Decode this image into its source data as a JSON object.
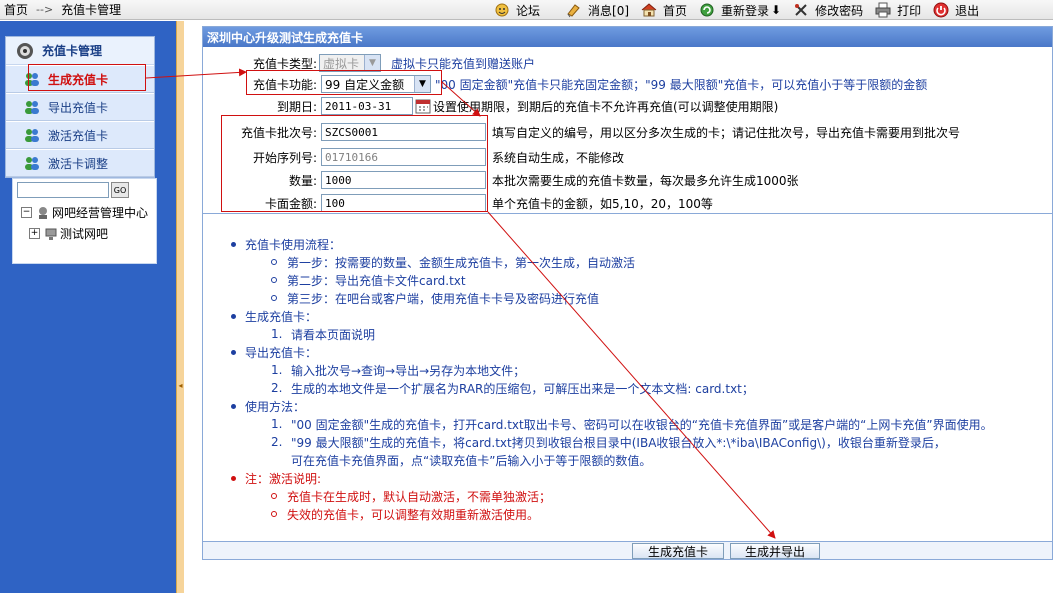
{
  "breadcrumb": {
    "home": "首页",
    "separator": "-->",
    "current": "充值卡管理"
  },
  "top_menu": [
    {
      "label": "论坛",
      "icon": "forum-icon"
    },
    {
      "label": "消息[0]",
      "icon": "message-icon"
    },
    {
      "label": "首页",
      "icon": "home-icon"
    },
    {
      "label": "重新登录",
      "icon": "relogin-icon"
    },
    {
      "label": "修改密码",
      "icon": "password-icon"
    },
    {
      "label": "打印",
      "icon": "print-icon"
    },
    {
      "label": "退出",
      "icon": "exit-icon"
    }
  ],
  "sidebar": {
    "title": "充值卡管理",
    "items": [
      {
        "label": "生成充值卡",
        "active": true
      },
      {
        "label": "导出充值卡",
        "active": false
      },
      {
        "label": "激活充值卡",
        "active": false
      },
      {
        "label": "激活卡调整",
        "active": false
      }
    ],
    "tree": {
      "search_value": "",
      "go_label": "GO",
      "nodes": [
        {
          "toggle": "−",
          "label": "网吧经营管理中心"
        },
        {
          "toggle": "+",
          "label": "测试网吧"
        }
      ]
    }
  },
  "panel": {
    "title": "深圳中心升级测试生成充值卡",
    "fields": {
      "card_type": {
        "label": "充值卡类型:",
        "value": "虚拟卡",
        "hint": "虚拟卡只能充值到赠送账户"
      },
      "card_func": {
        "label": "充值卡功能:",
        "value": "99 自定义金额",
        "hint_part1": "\"00 固定金额\"充值卡只能充固定金额；\"99 最大限额\"充值卡，可以充值小于等于限额的金额"
      },
      "expire": {
        "label": "到期日:",
        "value": "2011-03-31",
        "hint": "设置使用期限，到期后的充值卡不允许再充值(可以调整使用期限)"
      },
      "batch": {
        "label": "充值卡批次号:",
        "value": "SZCS0001",
        "hint": "填写自定义的编号，用以区分多次生成的卡；请记住批次号，导出充值卡需要用到批次号"
      },
      "start_serial": {
        "label": "开始序列号:",
        "value": "01710166",
        "hint": "系统自动生成，不能修改"
      },
      "quantity": {
        "label": "数量:",
        "value": "1000",
        "hint": "本批次需要生成的充值卡数量，每次最多允许生成1000张"
      },
      "face_value": {
        "label": "卡面金额:",
        "value": "100",
        "hint": "单个充值卡的金额，如5,10，20，100等"
      }
    },
    "instructions": {
      "s1": "充值卡使用流程：",
      "s1_1": "第一步：按需要的数量、金额生成充值卡，第一次生成，自动激活",
      "s1_2": "第二步：导出充值卡文件card.txt",
      "s1_3": "第三步：在吧台或客户端，使用充值卡卡号及密码进行充值",
      "s2": "生成充值卡：",
      "s2_1": "请看本页面说明",
      "s3": "导出充值卡：",
      "s3_1": "输入批次号→查询→导出→另存为本地文件；",
      "s3_2": "生成的本地文件是一个扩展名为RAR的压缩包，可解压出来是一个文本文档: card.txt；",
      "s4": "使用方法：",
      "s4_1": "\"00 固定金额\"生成的充值卡，打开card.txt取出卡号、密码可以在收银台的“充值卡充值界面”或是客户端的“上网卡充值”界面使用。",
      "s4_2": "\"99 最大限额\"生成的充值卡，将card.txt拷贝到收银台根目录中(IBA收银台放入*:\\*iba\\IBAConfig\\)，收银台重新登录后，",
      "s4_2b": "可在充值卡充值界面，点“读取充值卡”后输入小于等于限额的数值。",
      "s5": "注：激活说明:",
      "s5_1": "充值卡在生成时，默认自动激活，不需单独激活；",
      "s5_2": "失效的充值卡，可以调整有效期重新激活使用。",
      "n1": "1.",
      "n2": "2."
    },
    "buttons": {
      "generate": "生成充值卡",
      "generate_export": "生成并导出"
    }
  },
  "colors": {
    "sidebar_bg": "#2f63c4",
    "title_bg": "#4a78c8",
    "annotation_red": "#d01010",
    "link_blue": "#1d3fa0"
  }
}
